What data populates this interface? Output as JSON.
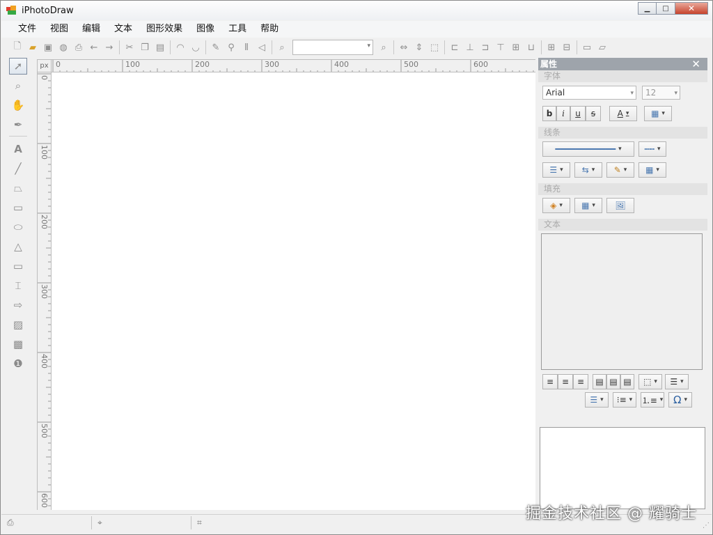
{
  "window": {
    "title": "iPhotoDraw",
    "minimize": "▭",
    "maximize": "□",
    "close": "✕"
  },
  "menu": [
    "文件",
    "视图",
    "编辑",
    "文本",
    "图形效果",
    "图像",
    "工具",
    "帮助"
  ],
  "toolbar": {
    "icons": [
      "new-file-icon",
      "open-folder-icon",
      "save-icon",
      "web-icon",
      "print-preview-icon",
      "undo-icon",
      "redo-icon",
      "cut-icon",
      "copy-icon",
      "paste-icon",
      "group-icon",
      "ungroup-icon",
      "edit-icon",
      "brush-icon",
      "flip-icon",
      "perspective-icon",
      "zoom-out-icon",
      "zoom-combo",
      "zoom-in-icon",
      "fit-width-icon",
      "fit-height-icon",
      "fit-page-icon",
      "align-left-icon",
      "align-center-icon",
      "align-right-icon",
      "align-top-icon",
      "align-middle-icon",
      "align-bottom-icon",
      "size-width-icon",
      "size-height-icon",
      "bring-front-icon",
      "send-back-icon"
    ],
    "zoom_value": ""
  },
  "tools": [
    "select-tool-icon",
    "zoom-tool-icon",
    "pan-tool-icon",
    "pen-tool-icon",
    "text-tool-icon",
    "line-tool-icon",
    "polygon-tool-icon",
    "rectangle-tool-icon",
    "ellipse-tool-icon",
    "triangle-tool-icon",
    "callout-tool-icon",
    "dimension-tool-icon",
    "arrow-tool-icon",
    "image-tool-icon",
    "crop-tool-icon",
    "number-tool-icon"
  ],
  "ruler": {
    "unit": "px",
    "x_ticks": [
      "0",
      "100",
      "200",
      "300",
      "400",
      "500",
      "600"
    ],
    "y_ticks": [
      "0",
      "100",
      "200",
      "300",
      "400",
      "500",
      "600"
    ]
  },
  "properties": {
    "header": "属性",
    "close": "✕",
    "font_section": "字体",
    "font_family": "Arial",
    "font_size": "12",
    "bold": "b",
    "italic": "i",
    "underline": "u",
    "strike": "s",
    "font_color": "A",
    "line_section": "线条",
    "fill_section": "填充",
    "text_section": "文本"
  },
  "watermark": "掘金技术社区 @ 耀骑士"
}
